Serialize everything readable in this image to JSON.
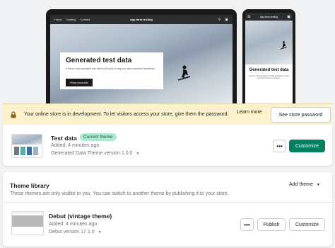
{
  "preview": {
    "laptop": {
      "nav_links": [
        "Home",
        "Catalog",
        "Contact"
      ],
      "store_name": "app-farm-testing",
      "hero_title": "Generated test data",
      "hero_subtitle": "A theme and populated test data by Shopify to help you test commerce primitives.",
      "hero_button": "Shop products"
    },
    "phone": {
      "store_name": "app-farm-testing",
      "hero_title": "Generated test data",
      "hero_subtitle": "A theme and populated test data by Shopify to help you test commerce primitives."
    }
  },
  "banner": {
    "text": "Your online store is in development. To let visitors access your store, give them the password.",
    "learn_more": "Learn more",
    "see_password": "See store password",
    "bg_color": "#fcf1cd"
  },
  "current_theme": {
    "name": "Test data",
    "badge": "Current theme",
    "added": "Added: 4 minutes ago",
    "version": "Generated Data Theme version 1.0.0",
    "more_label": "•••",
    "customize": "Customize",
    "accent": "#008060"
  },
  "library": {
    "title": "Theme library",
    "add_theme": "Add theme",
    "description": "These themes are only visible to you. You can switch to another theme by publishing it to your store.",
    "themes": [
      {
        "name": "Debut (vintage theme)",
        "added": "Added: 4 minutes ago",
        "version": "Debut version 17.1.0",
        "more_label": "•••",
        "publish": "Publish",
        "customize": "Customize"
      }
    ]
  },
  "icons": {
    "lock": "lock-icon",
    "caret": "caret-down-icon",
    "search": "search-icon",
    "cart": "cart-icon",
    "menu": "menu-icon"
  }
}
